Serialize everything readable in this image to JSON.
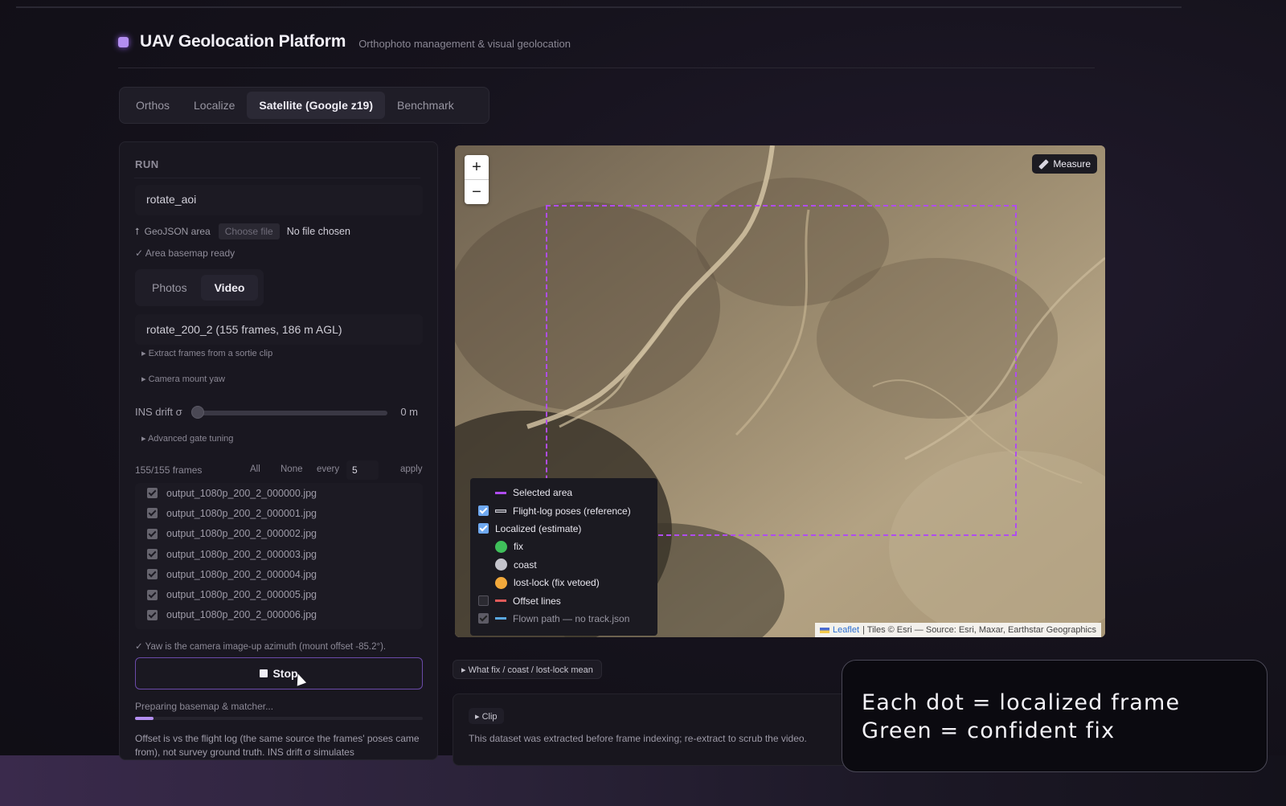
{
  "header": {
    "title": "UAV Geolocation Platform",
    "subtitle": "Orthophoto management & visual geolocation",
    "accent_color": "#b38ef0"
  },
  "tabs": [
    {
      "label": "Orthos",
      "active": false
    },
    {
      "label": "Localize",
      "active": false
    },
    {
      "label": "Satellite (Google z19)",
      "active": true
    },
    {
      "label": "Benchmark",
      "active": false
    }
  ],
  "run_panel": {
    "section_label": "RUN",
    "run_name": "rotate_aoi",
    "geojson": {
      "label": "GeoJSON area",
      "upload_icon": "upload-arrow-icon",
      "choose_file": "Choose file",
      "no_file": "No file chosen"
    },
    "basemap_status": "✓ Area basemap ready",
    "source_tabs": [
      {
        "label": "Photos",
        "active": false
      },
      {
        "label": "Video",
        "active": true
      }
    ],
    "video_selected": "rotate_200_2 (155 frames, 186 m AGL)",
    "disclosures": {
      "extract": "▸ Extract frames from a sortie clip",
      "camera_yaw": "▸ Camera mount yaw",
      "gate_tuning": "▸ Advanced gate tuning"
    },
    "ins_drift": {
      "label": "INS drift σ",
      "value": "0 m",
      "level": 0
    },
    "frames": {
      "count": "155/155 frames",
      "all": "All",
      "none": "None",
      "every_label": "every",
      "every_value": "5",
      "apply": "apply"
    },
    "files": [
      "output_1080p_200_2_000000.jpg",
      "output_1080p_200_2_000001.jpg",
      "output_1080p_200_2_000002.jpg",
      "output_1080p_200_2_000003.jpg",
      "output_1080p_200_2_000004.jpg",
      "output_1080p_200_2_000005.jpg",
      "output_1080p_200_2_000006.jpg"
    ],
    "yaw_note": "✓ Yaw is the camera image-up azimuth (mount offset -85.2°).",
    "stop_label": "Stop",
    "progress_text": "Preparing basemap & matcher...",
    "progress_fraction": 0.065,
    "offset_note": "Offset is vs the flight log (the same source the frames' poses came from), not survey ground truth. INS drift σ simulates"
  },
  "map": {
    "zoom_in": "+",
    "zoom_out": "−",
    "measure_label": "Measure",
    "measure_icon": "ruler-icon",
    "aoi_color": "#b04cf0",
    "legend": [
      {
        "kind": "line",
        "label": "Selected area",
        "color": "#b04cf0",
        "checkbox": null
      },
      {
        "kind": "line",
        "label": "Flight-log poses (reference)",
        "color": "#d0d0d8",
        "checkbox": "on"
      },
      {
        "kind": "none",
        "label": "Localized (estimate)",
        "checkbox": "on"
      },
      {
        "kind": "dot",
        "label": "fix",
        "color": "#3fbf5a"
      },
      {
        "kind": "dot",
        "label": "coast",
        "color": "#c4c4cc"
      },
      {
        "kind": "dot",
        "label": "lost-lock (fix vetoed)",
        "color": "#f2a93b"
      },
      {
        "kind": "line",
        "label": "Offset lines",
        "color": "#e05a5a",
        "checkbox": "off"
      },
      {
        "kind": "line",
        "label": "Flown path — no track.json",
        "color": "#5aa8e0",
        "checkbox": "dim"
      }
    ],
    "attribution": {
      "leaflet": "Leaflet",
      "rest": "| Tiles © Esri — Source: Esri, Maxar, Earthstar Geographics"
    }
  },
  "below_map": {
    "what_chip": "▸ What fix / coast / lost-lock mean",
    "clip_chip": "▸ Clip",
    "clip_note": "This dataset was extracted before frame indexing; re-extract to scrub the video."
  },
  "caption": {
    "line1": "Each dot = localized frame",
    "line2": "Green = confident fix"
  }
}
